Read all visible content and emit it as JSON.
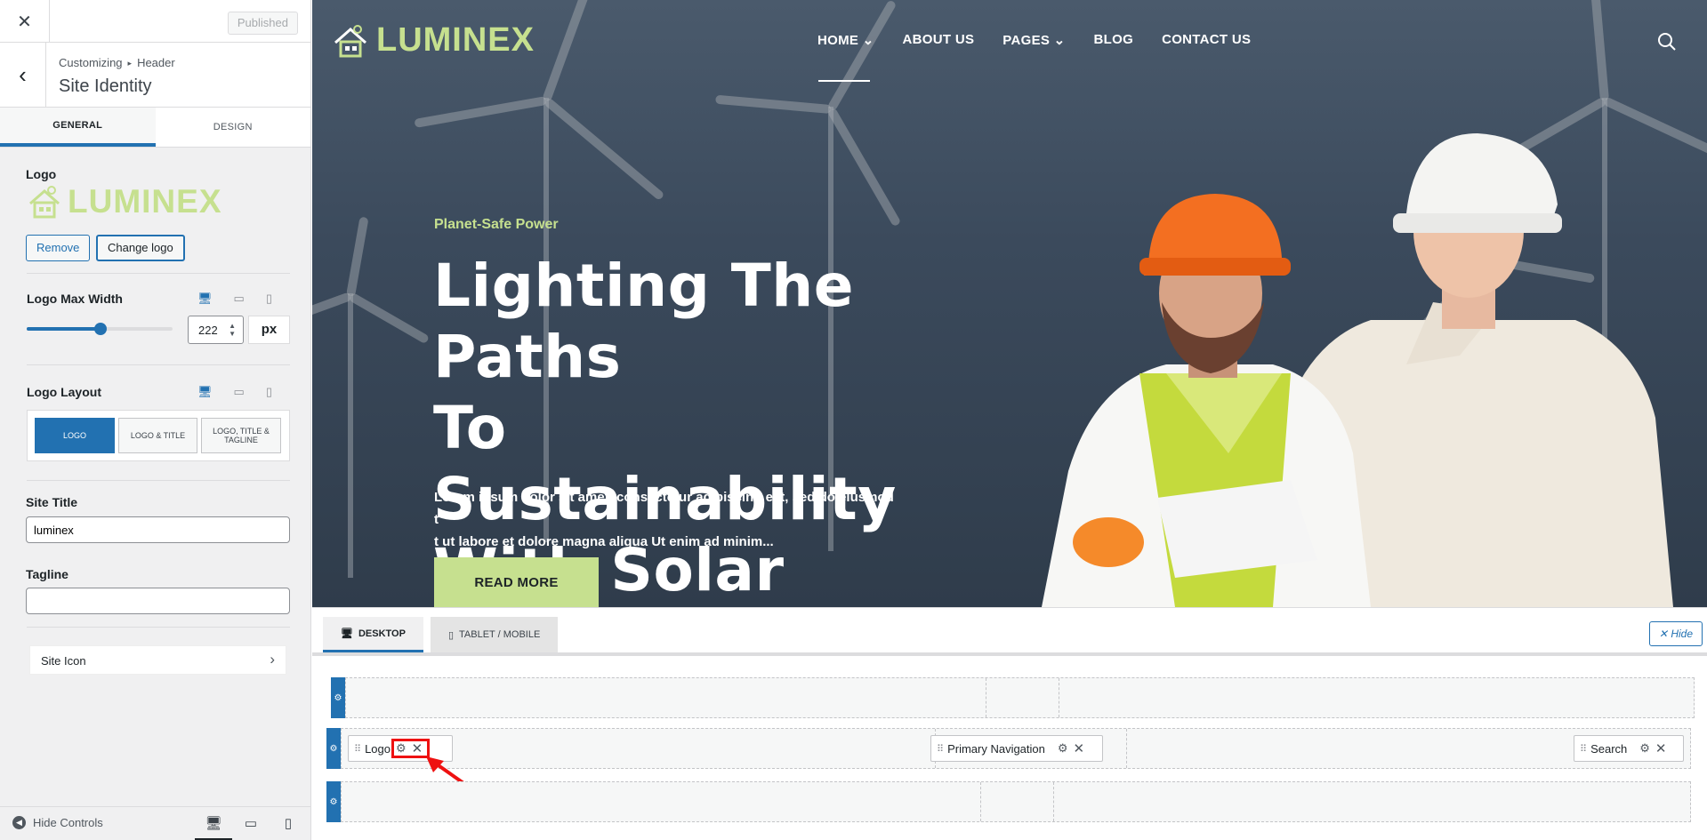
{
  "sidebar": {
    "close_icon": "close-icon",
    "published_label": "Published",
    "breadcrumb": {
      "root": "Customizing",
      "section": "Header"
    },
    "section_title": "Site Identity",
    "tabs": [
      {
        "label": "GENERAL"
      },
      {
        "label": "DESIGN"
      }
    ],
    "logo": {
      "label": "Logo",
      "image_text": "LUMINEX",
      "remove_label": "Remove",
      "change_label": "Change logo"
    },
    "logo_max_width": {
      "label": "Logo Max Width",
      "value": "222",
      "unit": "px",
      "slider_fraction": 0.45
    },
    "logo_layout": {
      "label": "Logo Layout",
      "options": [
        "LOGO",
        "LOGO & TITLE",
        "LOGO, TITLE & TAGLINE"
      ],
      "selected": "LOGO"
    },
    "site_title": {
      "label": "Site Title",
      "value": "luminex"
    },
    "tagline": {
      "label": "Tagline",
      "value": ""
    },
    "site_icon": {
      "label": "Site Icon"
    },
    "footer": {
      "hide_controls_label": "Hide Controls"
    }
  },
  "preview": {
    "logo_text": "LUMINEX",
    "nav": [
      {
        "label": "HOME ⌄"
      },
      {
        "label": "ABOUT US"
      },
      {
        "label": "PAGES ⌄"
      },
      {
        "label": "BLOG"
      },
      {
        "label": "CONTACT US"
      }
    ],
    "hero": {
      "eyebrow": "Planet-Safe Power",
      "heading_lines": [
        "Lighting The Paths",
        "To Sustainability",
        "With Solar"
      ],
      "paragraph_lines": [
        "Lorem ipsum dolor sit amet, consectetur adipiscing elit, sed do eiusmod t",
        "t ut labore et dolore magna aliqua Ut enim ad minim..."
      ],
      "button_label": "READ MORE"
    }
  },
  "builder": {
    "tabs": [
      {
        "label": "DESKTOP"
      },
      {
        "label": "TABLET / MOBILE"
      }
    ],
    "hide_label": "Hide",
    "items": {
      "logo": "Logo",
      "primary_nav": "Primary Navigation",
      "search": "Search"
    }
  },
  "colors": {
    "accent": "#2271b1",
    "brand_green": "#c6e08f",
    "highlight": "#e11111"
  }
}
